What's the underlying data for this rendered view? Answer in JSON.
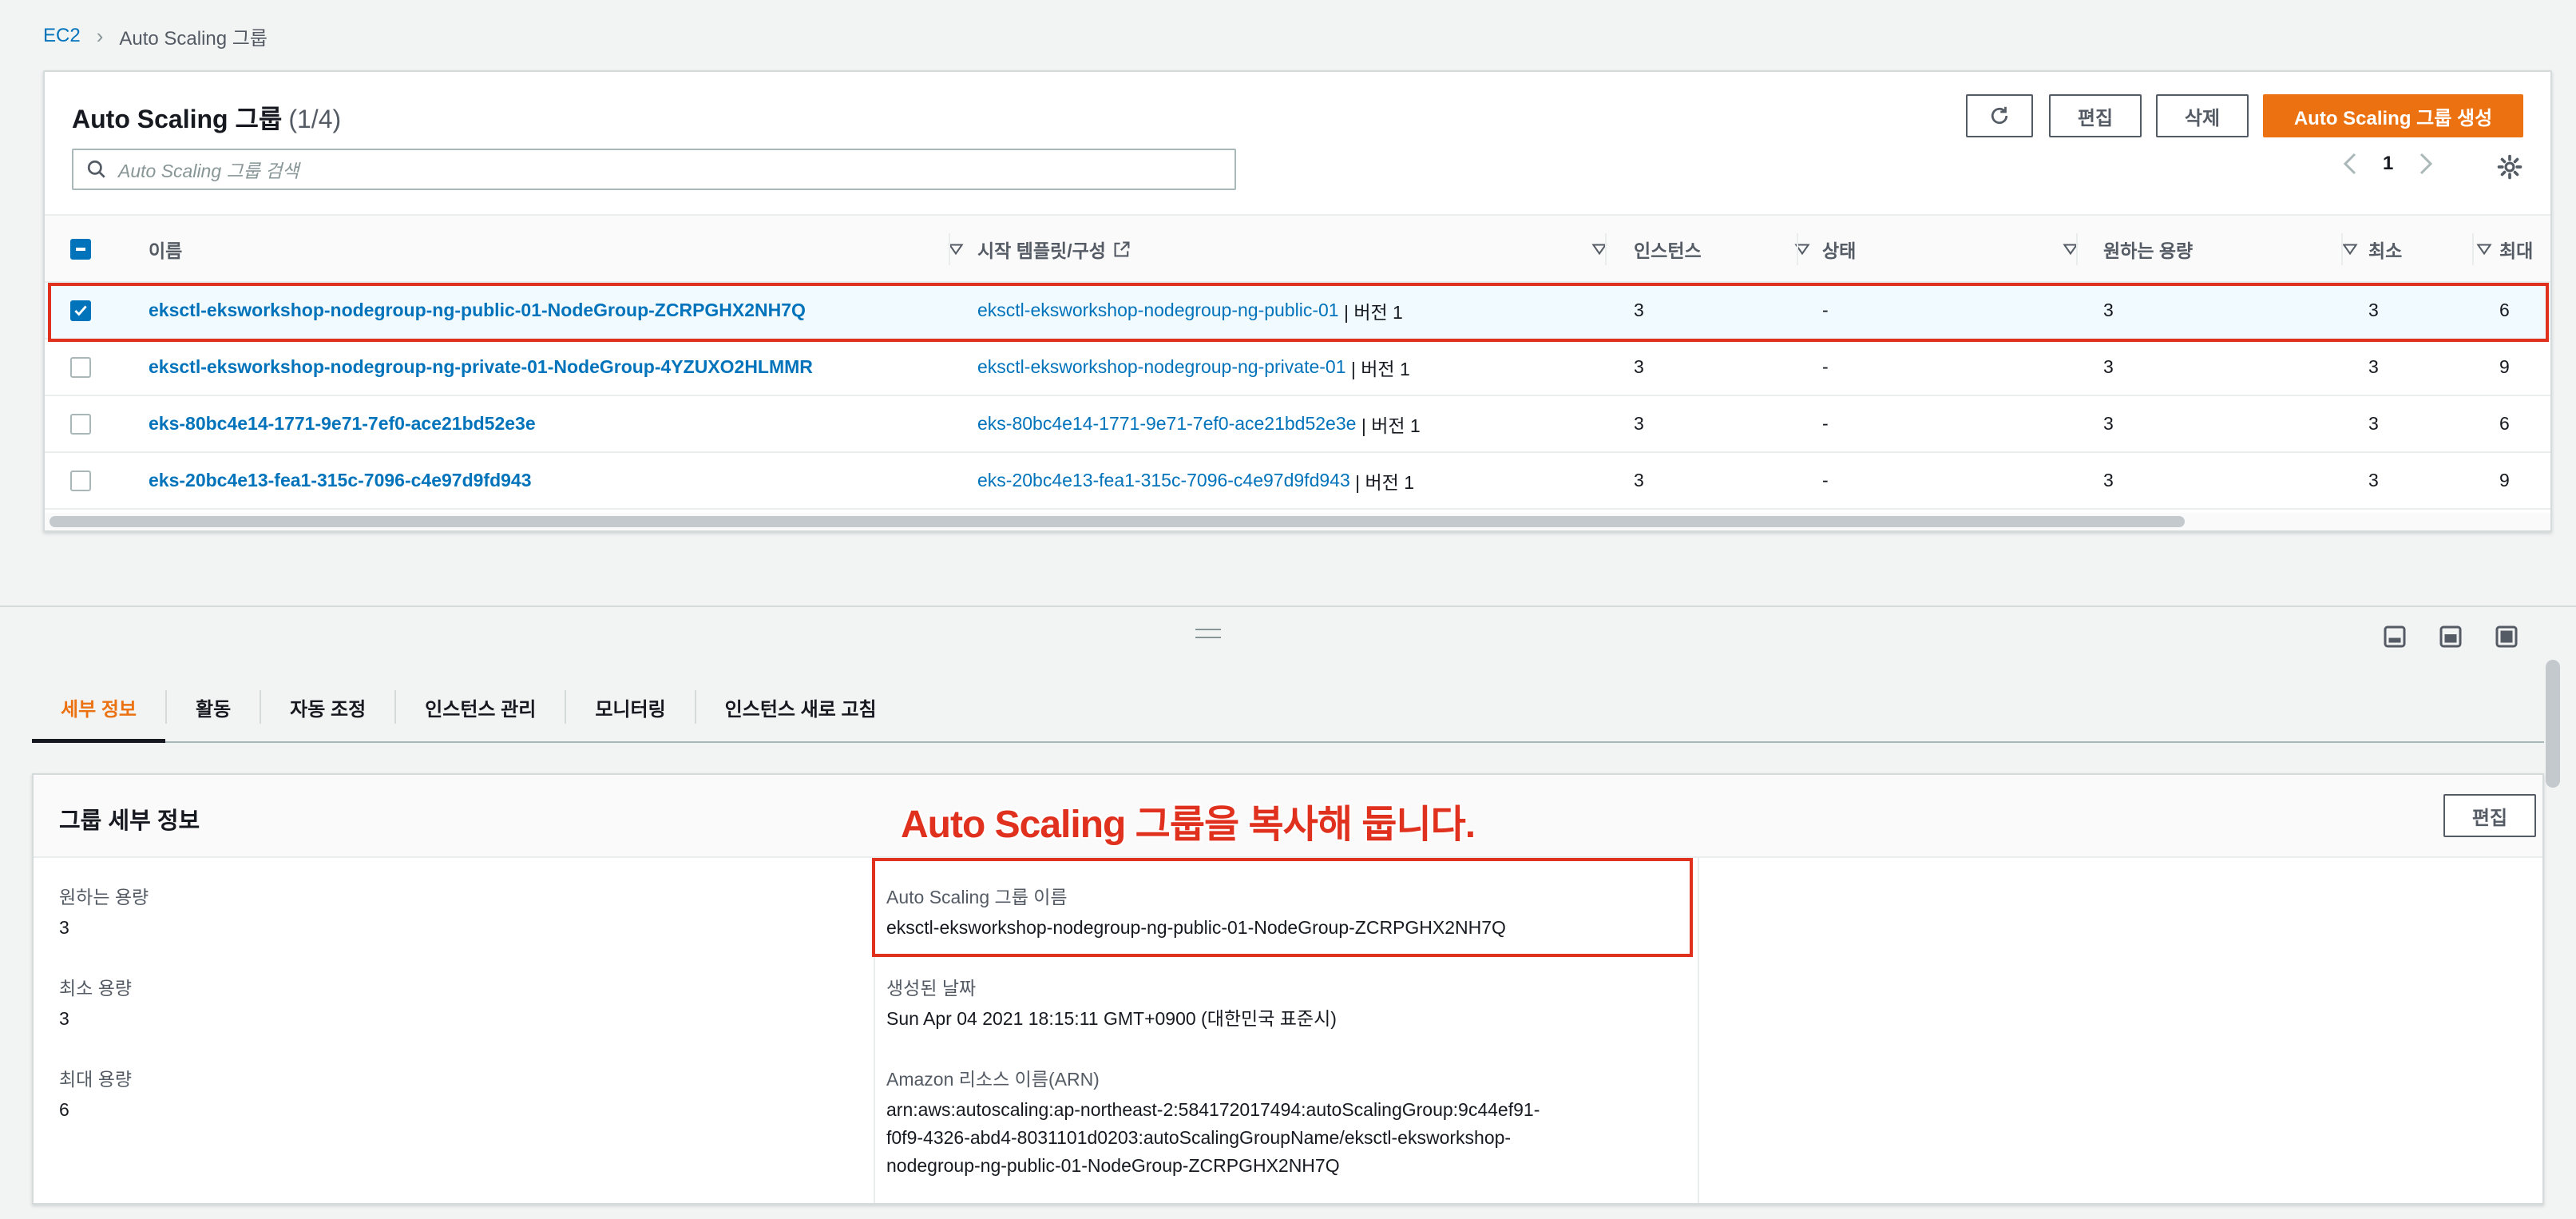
{
  "breadcrumb": {
    "root": "EC2",
    "current": "Auto Scaling 그룹"
  },
  "groups": {
    "title": "Auto Scaling 그룹",
    "count": "(1/4)",
    "buttons": {
      "edit": "편집",
      "delete": "삭제",
      "create": "Auto Scaling 그룹 생성"
    },
    "search_placeholder": "Auto Scaling 그룹 검색",
    "page": "1",
    "columns": [
      "이름",
      "시작 템플릿/구성",
      "인스턴스",
      "상태",
      "원하는 용량",
      "최소",
      "최대"
    ],
    "rows": [
      {
        "name": "eksctl-eksworkshop-nodegroup-ng-public-01-NodeGroup-ZCRPGHX2NH7Q",
        "template": "eksctl-eksworkshop-nodegroup-ng-public-01",
        "version": "| 버전 1",
        "instances": "3",
        "status": "-",
        "desired": "3",
        "min": "3",
        "max": "6",
        "selected": true
      },
      {
        "name": "eksctl-eksworkshop-nodegroup-ng-private-01-NodeGroup-4YZUXO2HLMMR",
        "template": "eksctl-eksworkshop-nodegroup-ng-private-01",
        "version": "| 버전 1",
        "instances": "3",
        "status": "-",
        "desired": "3",
        "min": "3",
        "max": "9",
        "selected": false
      },
      {
        "name": "eks-80bc4e14-1771-9e71-7ef0-ace21bd52e3e",
        "template": "eks-80bc4e14-1771-9e71-7ef0-ace21bd52e3e",
        "version": "| 버전 1",
        "instances": "3",
        "status": "-",
        "desired": "3",
        "min": "3",
        "max": "6",
        "selected": false
      },
      {
        "name": "eks-20bc4e13-fea1-315c-7096-c4e97d9fd943",
        "template": "eks-20bc4e13-fea1-315c-7096-c4e97d9fd943",
        "version": "| 버전 1",
        "instances": "3",
        "status": "-",
        "desired": "3",
        "min": "3",
        "max": "9",
        "selected": false
      }
    ]
  },
  "tabs": [
    "세부 정보",
    "활동",
    "자동 조정",
    "인스턴스 관리",
    "모니터링",
    "인스턴스 새로 고침"
  ],
  "details": {
    "title": "그룹 세부 정보",
    "edit": "편집",
    "annotation": "Auto Scaling 그룹을 복사해 둡니다.",
    "desired_label": "원하는 용량",
    "desired_value": "3",
    "min_label": "최소 용량",
    "min_value": "3",
    "max_label": "최대 용량",
    "max_value": "6",
    "asg_name_label": "Auto Scaling 그룹 이름",
    "asg_name_value": "eksctl-eksworkshop-nodegroup-ng-public-01-NodeGroup-ZCRPGHX2NH7Q",
    "created_label": "생성된 날짜",
    "created_value": "Sun Apr 04 2021 18:15:11 GMT+0900 (대한민국 표준시)",
    "arn_label": "Amazon 리소스 이름(ARN)",
    "arn_lines": [
      "arn:aws:autoscaling:ap-northeast-2:584172017494:autoScalingGroup:9c44ef91-",
      "f0f9-4326-abd4-8031101d0203:autoScalingGroupName/eksctl-eksworkshop-",
      "nodegroup-ng-public-01-NodeGroup-ZCRPGHX2NH7Q"
    ]
  },
  "colors": {
    "link": "#0073bb",
    "accent": "#ec7211",
    "annotation_red": "#e0301e"
  }
}
